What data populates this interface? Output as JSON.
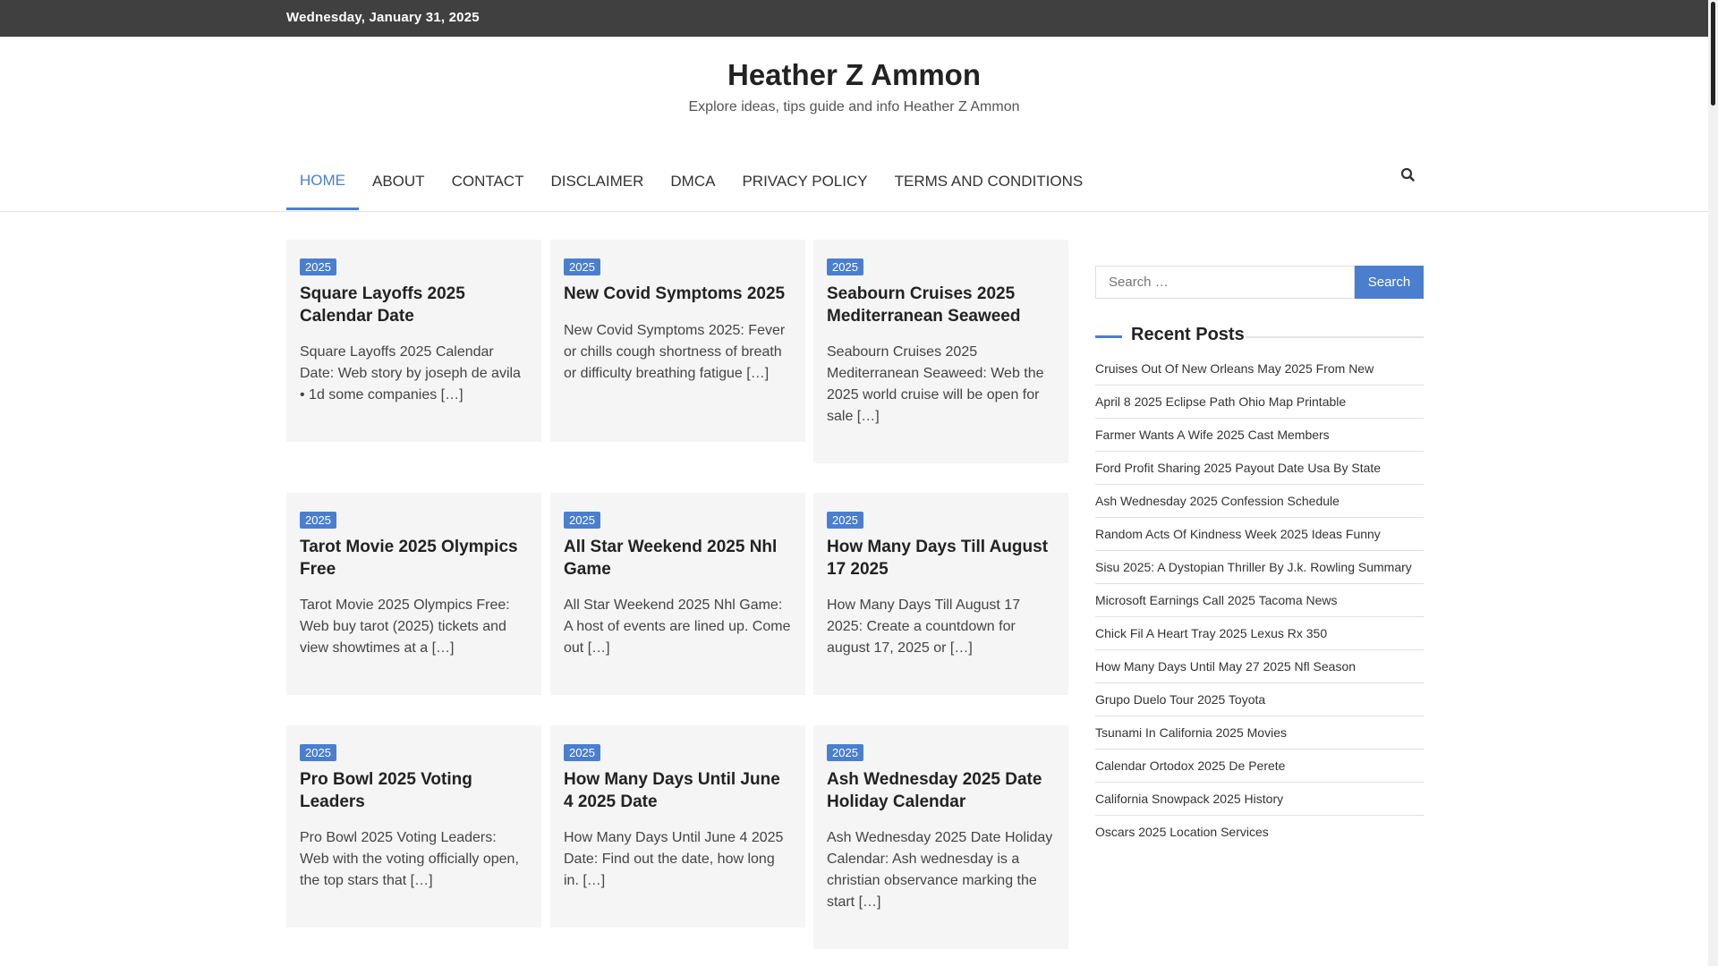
{
  "topbar": {
    "date": "Wednesday, January 31, 2025"
  },
  "site": {
    "title": "Heather Z Ammon",
    "description": "Explore ideas, tips guide and info Heather Z Ammon"
  },
  "nav": {
    "items": [
      "HOME",
      "ABOUT",
      "CONTACT",
      "DISCLAIMER",
      "DMCA",
      "PRIVACY POLICY",
      "TERMS AND CONDITIONS"
    ],
    "active": "HOME",
    "search_icon": "search-icon"
  },
  "posts": [
    {
      "category": "2025",
      "title": "Square Layoffs 2025 Calendar Date",
      "excerpt": "Square Layoffs 2025 Calendar Date: Web story by joseph de avila • 1d some companies […]"
    },
    {
      "category": "2025",
      "title": "New Covid Symptoms 2025",
      "excerpt": "New Covid Symptoms 2025: Fever or chills cough shortness of breath or difficulty breathing fatigue […]"
    },
    {
      "category": "2025",
      "title": "Seabourn Cruises 2025 Mediterranean Seaweed",
      "excerpt": "Seabourn Cruises 2025 Mediterranean Seaweed: Web the 2025 world cruise will be open for sale […]"
    },
    {
      "category": "2025",
      "title": "Tarot Movie 2025 Olympics Free",
      "excerpt": "Tarot Movie 2025 Olympics Free: Web buy tarot (2025) tickets and view showtimes at a […]"
    },
    {
      "category": "2025",
      "title": "All Star Weekend 2025 Nhl Game",
      "excerpt": "All Star Weekend 2025 Nhl Game: A host of events are lined up. Come out […]"
    },
    {
      "category": "2025",
      "title": "How Many Days Till August 17 2025",
      "excerpt": "How Many Days Till August 17 2025: Create a countdown for august 17, 2025 or […]"
    },
    {
      "category": "2025",
      "title": "Pro Bowl 2025 Voting Leaders",
      "excerpt": "Pro Bowl 2025 Voting Leaders: Web with the voting officially open, the top stars that […]"
    },
    {
      "category": "2025",
      "title": "How Many Days Until June 4 2025 Date",
      "excerpt": "How Many Days Until June 4 2025 Date: Find out the date, how long in. […]"
    },
    {
      "category": "2025",
      "title": "Ash Wednesday 2025 Date Holiday Calendar",
      "excerpt": "Ash Wednesday 2025 Date Holiday Calendar: Ash wednesday is a christian observance marking the start […]"
    }
  ],
  "sidebar": {
    "search": {
      "placeholder": "Search …",
      "button": "Search"
    },
    "recent_title": "Recent Posts",
    "recent": [
      "Cruises Out Of New Orleans May 2025 From New",
      "April 8 2025 Eclipse Path Ohio Map Printable",
      "Farmer Wants A Wife 2025 Cast Members",
      "Ford Profit Sharing 2025 Payout Date Usa By State",
      "Ash Wednesday 2025 Confession Schedule",
      "Random Acts Of Kindness Week 2025 Ideas Funny",
      "Sisu 2025: A Dystopian Thriller By J.k. Rowling Summary",
      "Microsoft Earnings Call 2025 Tacoma News",
      "Chick Fil A Heart Tray 2025 Lexus Rx 350",
      "How Many Days Until May 27 2025 Nfl Season",
      "Grupo Duelo Tour 2025 Toyota",
      "Tsunami In California 2025 Movies",
      "Calendar Ortodox 2025 De Perete",
      "California Snowpack 2025 History",
      "Oscars 2025 Location Services"
    ]
  },
  "colors": {
    "accent": "#4a7fd0",
    "topbar": "#404040",
    "card_bg": "#f5f5f5"
  }
}
